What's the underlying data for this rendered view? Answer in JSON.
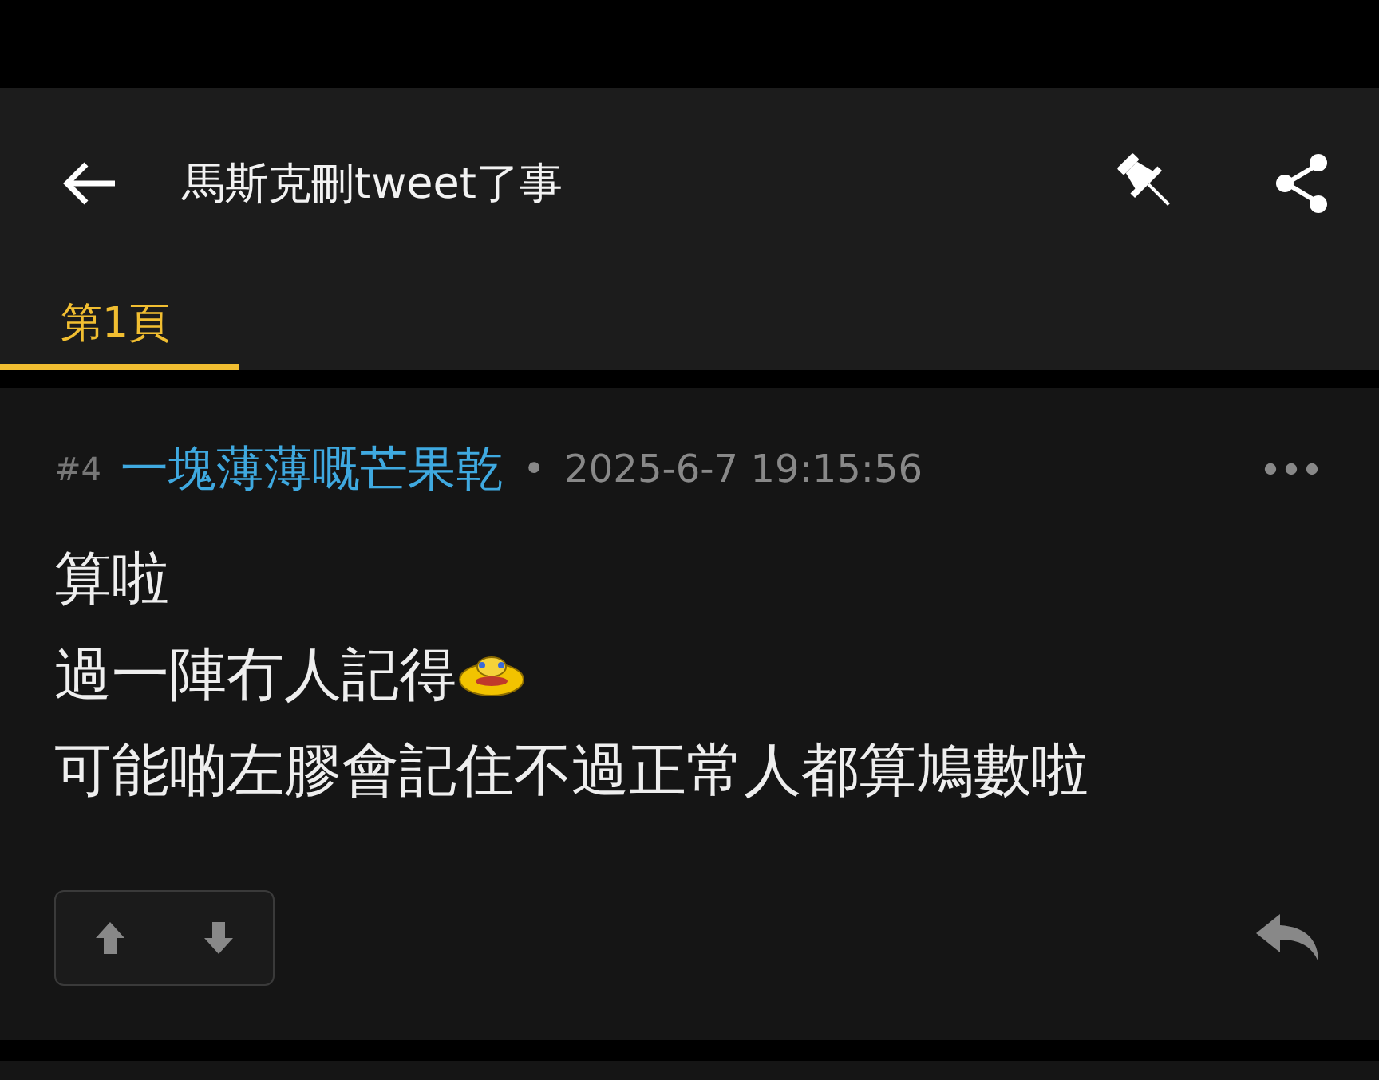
{
  "header": {
    "title": "馬斯克刪tweet了事"
  },
  "tabs": [
    {
      "label": "第1頁",
      "selected": true
    }
  ],
  "post": {
    "number": "#4",
    "author": "一塊薄薄嘅芒果乾",
    "separator": "•",
    "time": "2025-6-7 19:15:56",
    "lines": [
      {
        "text": "算啦",
        "emoji": false
      },
      {
        "text": "過一陣冇人記得",
        "emoji": true
      },
      {
        "text": "可能啲左膠會記住不過正常人都算鳩數啦",
        "emoji": false
      }
    ]
  }
}
